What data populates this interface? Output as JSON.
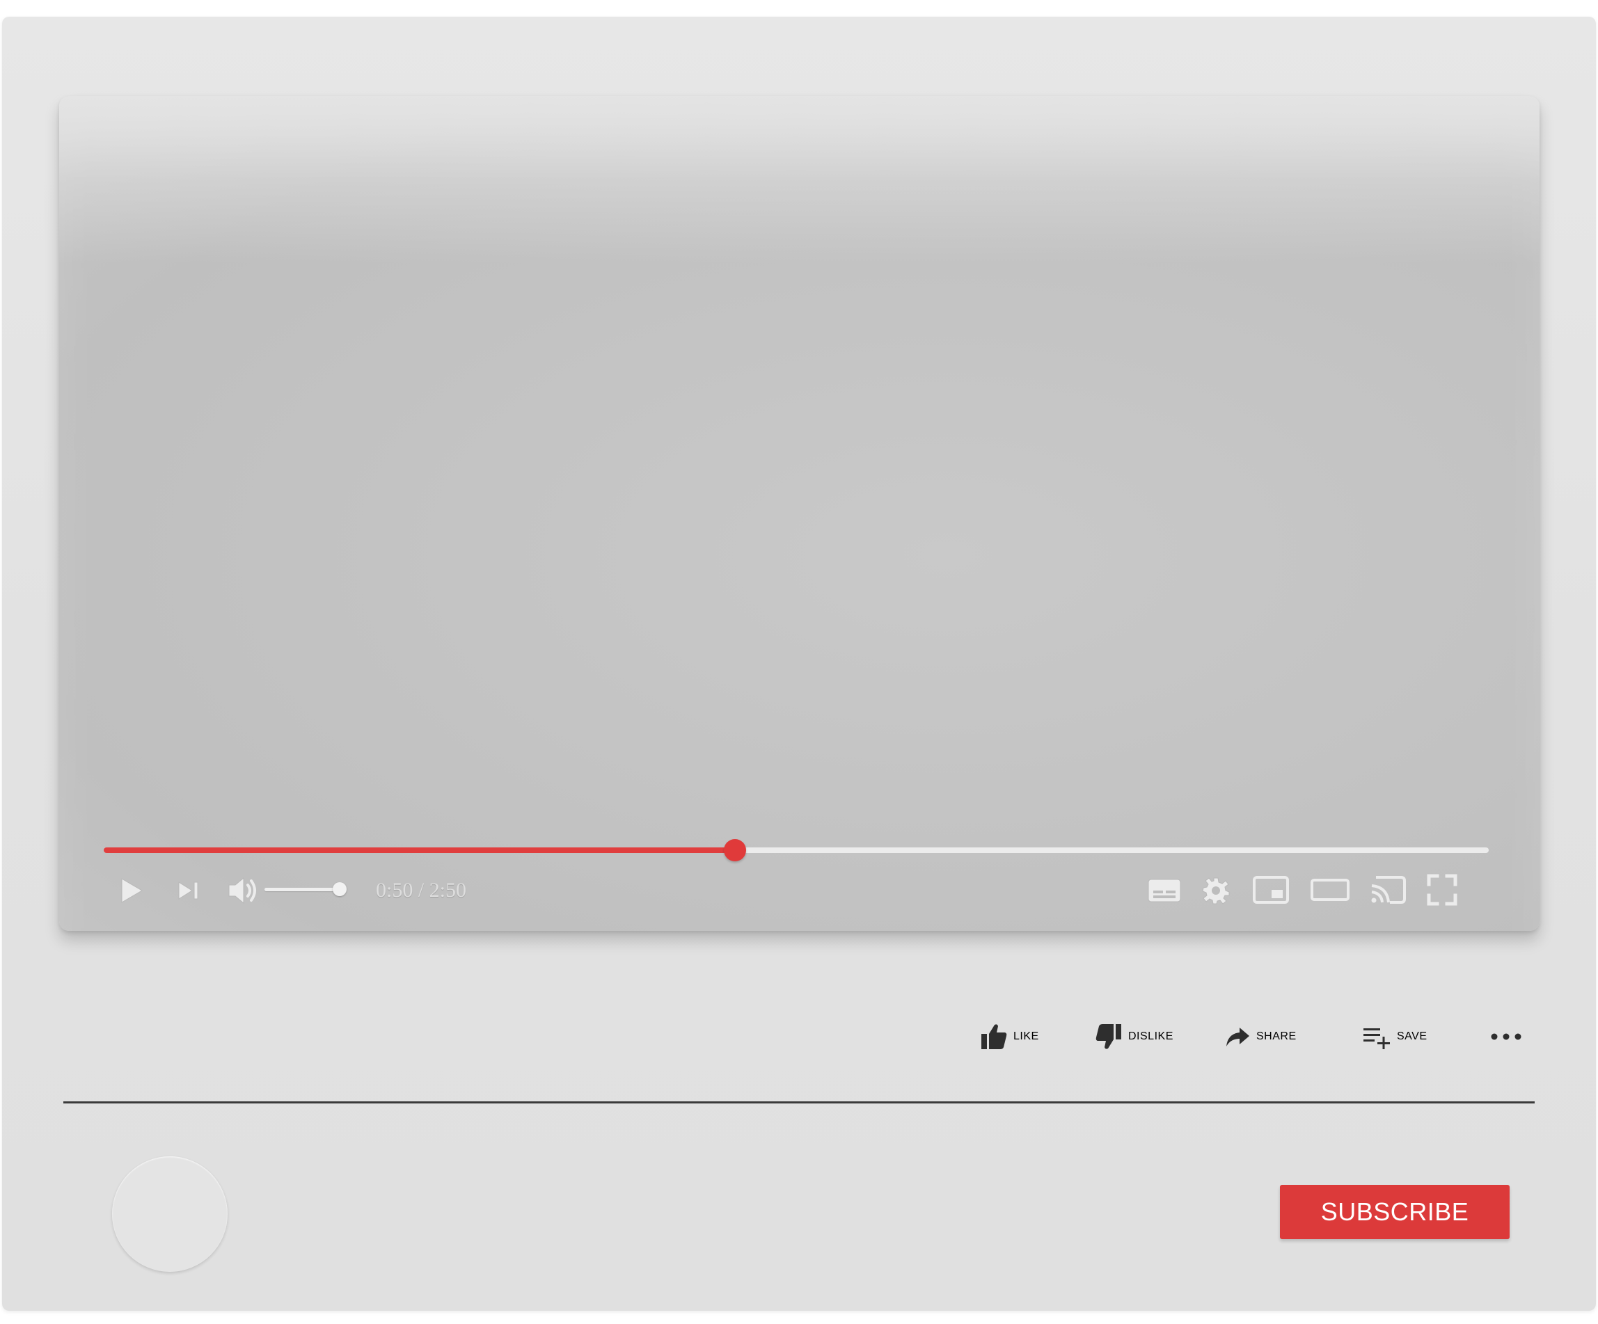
{
  "player": {
    "current_time": "0:50 / 2:50",
    "progress_fraction": 0.4559,
    "volume_fraction": 1.0,
    "accent_color": "#e03e3e",
    "controls_left": [
      "play-icon",
      "next-icon",
      "volume-icon"
    ],
    "controls_right": [
      "subtitles-icon",
      "settings-icon",
      "miniplayer-icon",
      "theater-mode-icon",
      "cast-icon",
      "fullscreen-icon"
    ]
  },
  "actions": {
    "like": "LIKE",
    "dislike": "DISLIKE",
    "share": "SHARE",
    "save": "SAVE",
    "more_icon": "more-icon"
  },
  "channel": {
    "subscribe_label": "SUBSCRIBE",
    "subscribe_color": "#dc3a3a"
  }
}
